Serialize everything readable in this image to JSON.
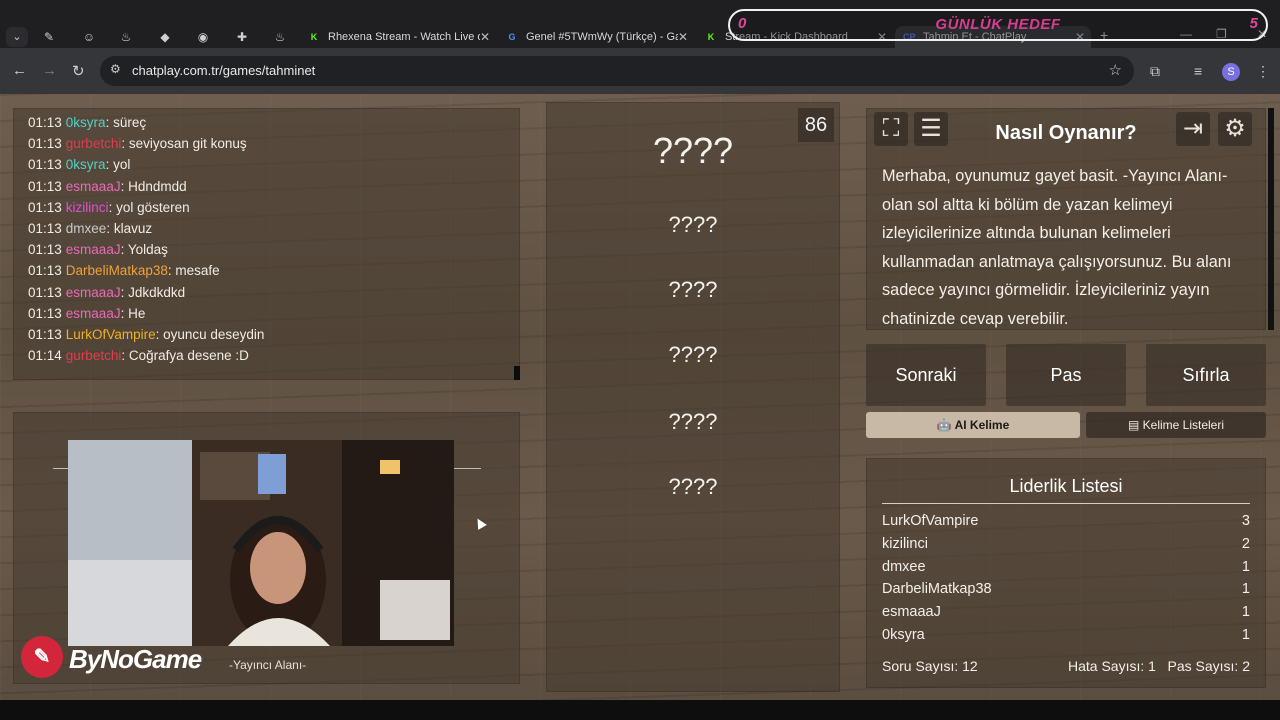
{
  "browser": {
    "tabs": [
      {
        "title": "Rhexena Stream - Watch Live o",
        "favicon": "K",
        "favicon_color": "#53fc18",
        "active": false
      },
      {
        "title": "Genel #5TWmWy (Türkçe) - Ga",
        "favicon": "G",
        "favicon_color": "#4f8df5",
        "active": false
      },
      {
        "title": "Stream - Kick Dashboard",
        "favicon": "K",
        "favicon_color": "#53fc18",
        "active": false
      },
      {
        "title": "Tahmin Et - ChatPlay",
        "favicon": "CP",
        "favicon_color": "#5b7cfa",
        "active": true
      }
    ],
    "url": "chatplay.com.tr/games/tahminet",
    "profile_initial": "S"
  },
  "daily_goal": {
    "title": "GÜNLÜK HEDEF",
    "current": "0",
    "target": "5"
  },
  "chat": [
    {
      "time": "01:13",
      "user": "0ksyra",
      "color": "#4fd1c5",
      "message": "süreç"
    },
    {
      "time": "01:13",
      "user": "gurbetchi",
      "color": "#e23b4f",
      "message": "seviyosan git konuş"
    },
    {
      "time": "01:13",
      "user": "0ksyra",
      "color": "#4fd1c5",
      "message": "yol"
    },
    {
      "time": "01:13",
      "user": "esmaaaJ",
      "color": "#e86ab8",
      "message": "Hdndmdd"
    },
    {
      "time": "01:13",
      "user": "kizilinci",
      "color": "#e04fd2",
      "message": "yol gösteren"
    },
    {
      "time": "01:13",
      "user": "dmxee",
      "color": "#c9c9c9",
      "message": "klavuz"
    },
    {
      "time": "01:13",
      "user": "esmaaaJ",
      "color": "#e86ab8",
      "message": "Yoldaş"
    },
    {
      "time": "01:13",
      "user": "DarbeliMatkap38",
      "color": "#f2a13b",
      "message": "mesafe"
    },
    {
      "time": "01:13",
      "user": "esmaaaJ",
      "color": "#e86ab8",
      "message": "Jdkdkdkd"
    },
    {
      "time": "01:13",
      "user": "esmaaaJ",
      "color": "#e86ab8",
      "message": "He"
    },
    {
      "time": "01:13",
      "user": "LurkOfVampire",
      "color": "#f0b020",
      "message": "oyuncu deseydin"
    },
    {
      "time": "01:14",
      "user": "gurbetchi",
      "color": "#e23b4f",
      "message": "Coğrafya desene :D"
    }
  ],
  "streamer": {
    "label": "-Yayıncı Alanı-",
    "brand": "ByNoGame"
  },
  "game": {
    "timer": "86",
    "words": [
      "????",
      "????",
      "????",
      "????",
      "????",
      "????"
    ]
  },
  "howto": {
    "title": "Nasıl Oynanır?",
    "text": "Merhaba, oyunumuz gayet basit. -Yayıncı Alanı- olan sol altta ki bölüm de yazan kelimeyi izleyicilerinize altında bulunan kelimeleri kullanmadan anlatmaya çalışıyorsunuz. Bu alanı sadece yayıncı görmelidir. İzleyicileriniz yayın chatinizde cevap verebilir."
  },
  "buttons": {
    "next": "Sonraki",
    "pass": "Pas",
    "reset": "Sıfırla",
    "ai_word": "AI Kelime",
    "word_lists": "Kelime Listeleri"
  },
  "leaderboard": {
    "title": "Liderlik Listesi",
    "rows": [
      {
        "name": "LurkOfVampire",
        "score": "3"
      },
      {
        "name": "kizilinci",
        "score": "2"
      },
      {
        "name": "dmxee",
        "score": "1"
      },
      {
        "name": "DarbeliMatkap38",
        "score": "1"
      },
      {
        "name": "esmaaaJ",
        "score": "1"
      },
      {
        "name": "0ksyra",
        "score": "1"
      }
    ],
    "question_count": "Soru Sayısı: 12",
    "error_count": "Hata Sayısı: 1",
    "pass_count": "Pas Sayısı: 2"
  }
}
